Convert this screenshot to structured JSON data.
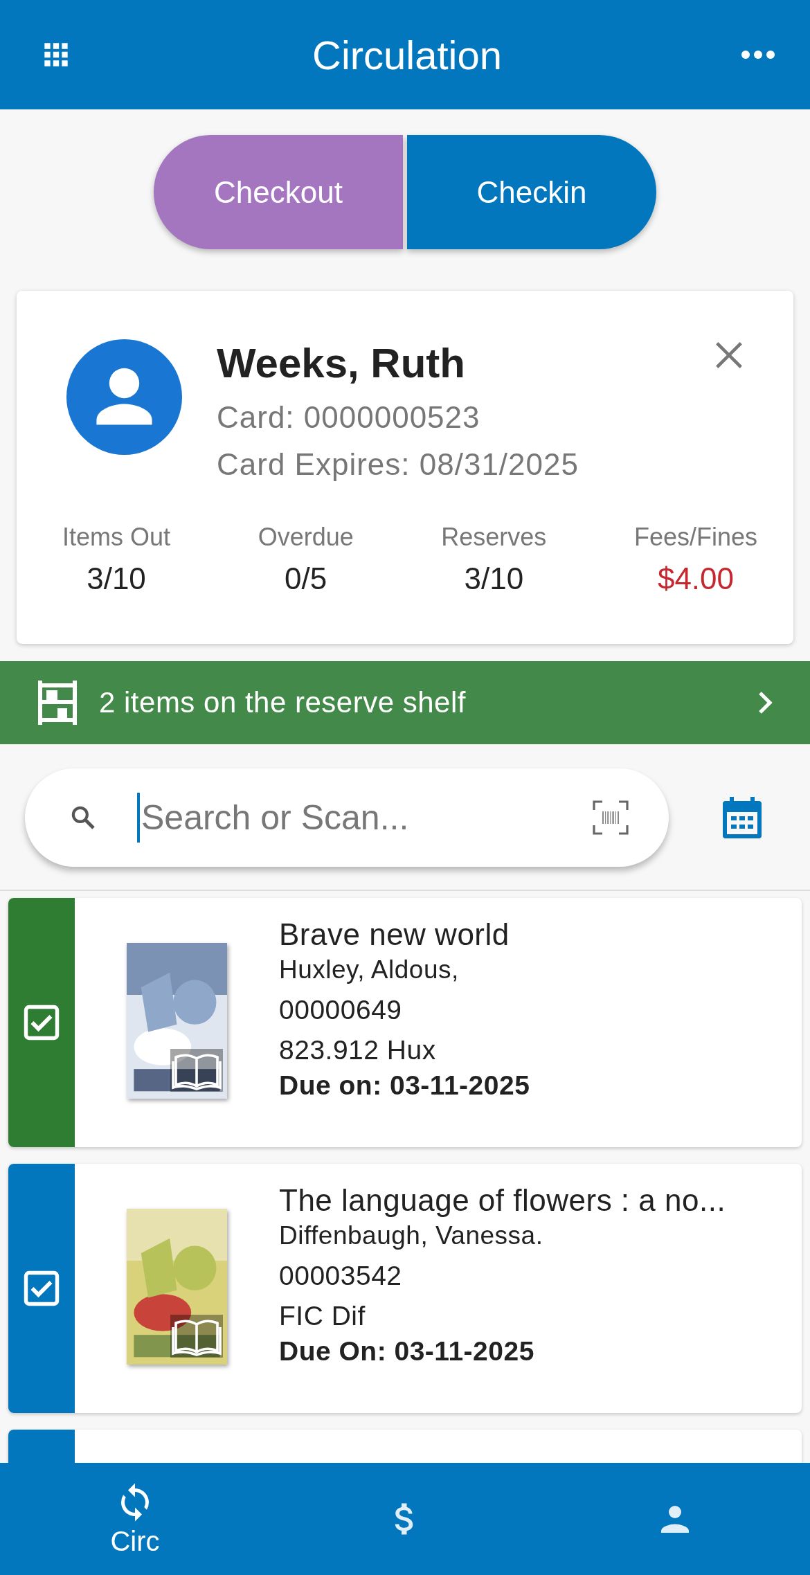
{
  "header": {
    "title": "Circulation"
  },
  "mode_tabs": [
    {
      "label": "Checkout",
      "selected": true
    },
    {
      "label": "Checkin",
      "selected": false
    }
  ],
  "patron": {
    "name": "Weeks, Ruth",
    "card": "Card: 0000000523",
    "expires": "Card Expires: 08/31/2025",
    "stats": [
      {
        "label": "Items Out",
        "value": "3/10",
        "alert": false
      },
      {
        "label": "Overdue",
        "value": "0/5",
        "alert": false
      },
      {
        "label": "Reserves",
        "value": "3/10",
        "alert": false
      },
      {
        "label": "Fees/Fines",
        "value": "$4.00",
        "alert": true
      }
    ]
  },
  "reserve_banner": {
    "text": "2 items on the reserve shelf"
  },
  "search": {
    "placeholder": "Search or Scan..."
  },
  "items": [
    {
      "title": "Brave new world",
      "author": "Huxley, Aldous,",
      "barcode": "00000649",
      "call_number": "823.912 Hux",
      "due": "Due on: 03-11-2025",
      "checked": true,
      "color": "#2e7d32"
    },
    {
      "title": "The language of flowers : a no...",
      "author": "Diffenbaugh, Vanessa.",
      "barcode": "00003542",
      "call_number": "FIC Dif",
      "due": "Due On: 03-11-2025",
      "checked": true,
      "color": "#0277bd"
    },
    {
      "color": "#0277bd"
    }
  ],
  "bottom_nav": [
    {
      "kind": "circ",
      "label": "Circ",
      "selected": true
    },
    {
      "kind": "fees",
      "selected": false
    },
    {
      "kind": "patron",
      "selected": false
    }
  ]
}
